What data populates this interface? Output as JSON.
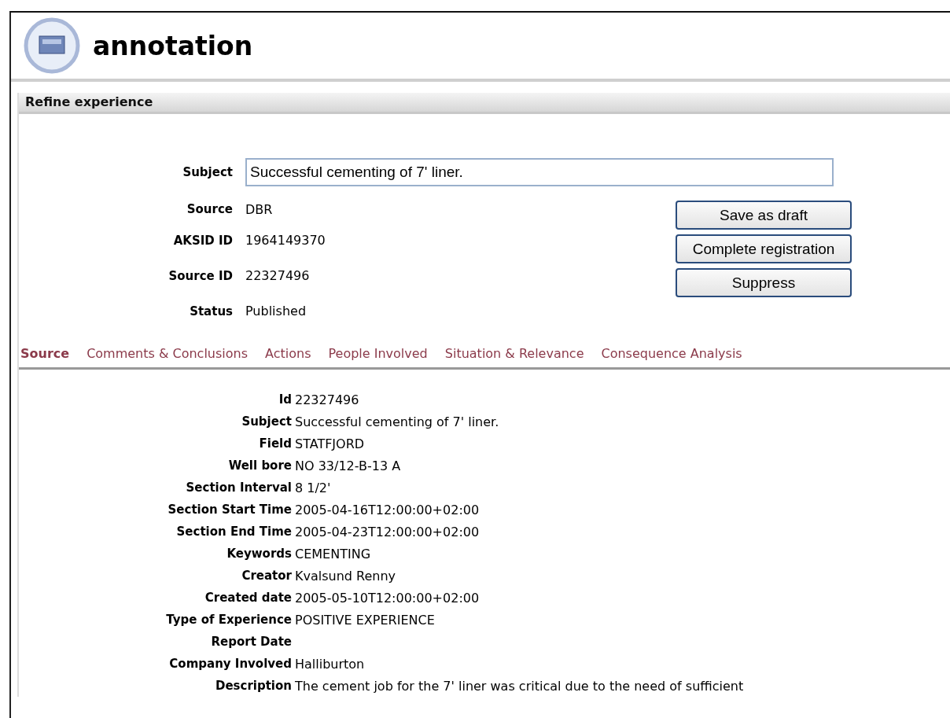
{
  "app_title": "annotation",
  "panel_title": "Refine experience",
  "subject": {
    "label": "Subject",
    "value": "Successful cementing of 7' liner."
  },
  "info": [
    {
      "label": "Source",
      "value": "DBR"
    },
    {
      "label": "AKSID ID",
      "value": "1964149370"
    },
    {
      "label": "Source ID",
      "value": "22327496"
    },
    {
      "label": "Status",
      "value": "Published"
    }
  ],
  "buttons": [
    "Save as draft",
    "Complete registration",
    "Suppress"
  ],
  "tabs": [
    {
      "label": "Source",
      "selected": true
    },
    {
      "label": "Comments & Conclusions",
      "selected": false
    },
    {
      "label": "Actions",
      "selected": false
    },
    {
      "label": "People Involved",
      "selected": false
    },
    {
      "label": "Situation & Relevance",
      "selected": false
    },
    {
      "label": "Consequence Analysis",
      "selected": false
    }
  ],
  "details": [
    {
      "label": "Id",
      "value": "22327496"
    },
    {
      "label": "Subject",
      "value": "Successful cementing of 7' liner."
    },
    {
      "label": "Field",
      "value": "STATFJORD"
    },
    {
      "label": "Well bore",
      "value": "NO 33/12-B-13 A"
    },
    {
      "label": "Section Interval",
      "value": "8 1/2'"
    },
    {
      "label": "Section Start Time",
      "value": "2005-04-16T12:00:00+02:00"
    },
    {
      "label": "Section End Time",
      "value": "2005-04-23T12:00:00+02:00"
    },
    {
      "label": "Keywords",
      "value": "CEMENTING"
    },
    {
      "label": "Creator",
      "value": "Kvalsund Renny"
    },
    {
      "label": "Created date",
      "value": "2005-05-10T12:00:00+02:00"
    },
    {
      "label": "Type of Experience",
      "value": "POSITIVE EXPERIENCE"
    },
    {
      "label": "Report Date"
    },
    {
      "label": "Company Involved",
      "value": "Halliburton"
    },
    {
      "label": "Description",
      "value": "The cement job for the 7' liner was critical due to the need of sufficient"
    }
  ]
}
